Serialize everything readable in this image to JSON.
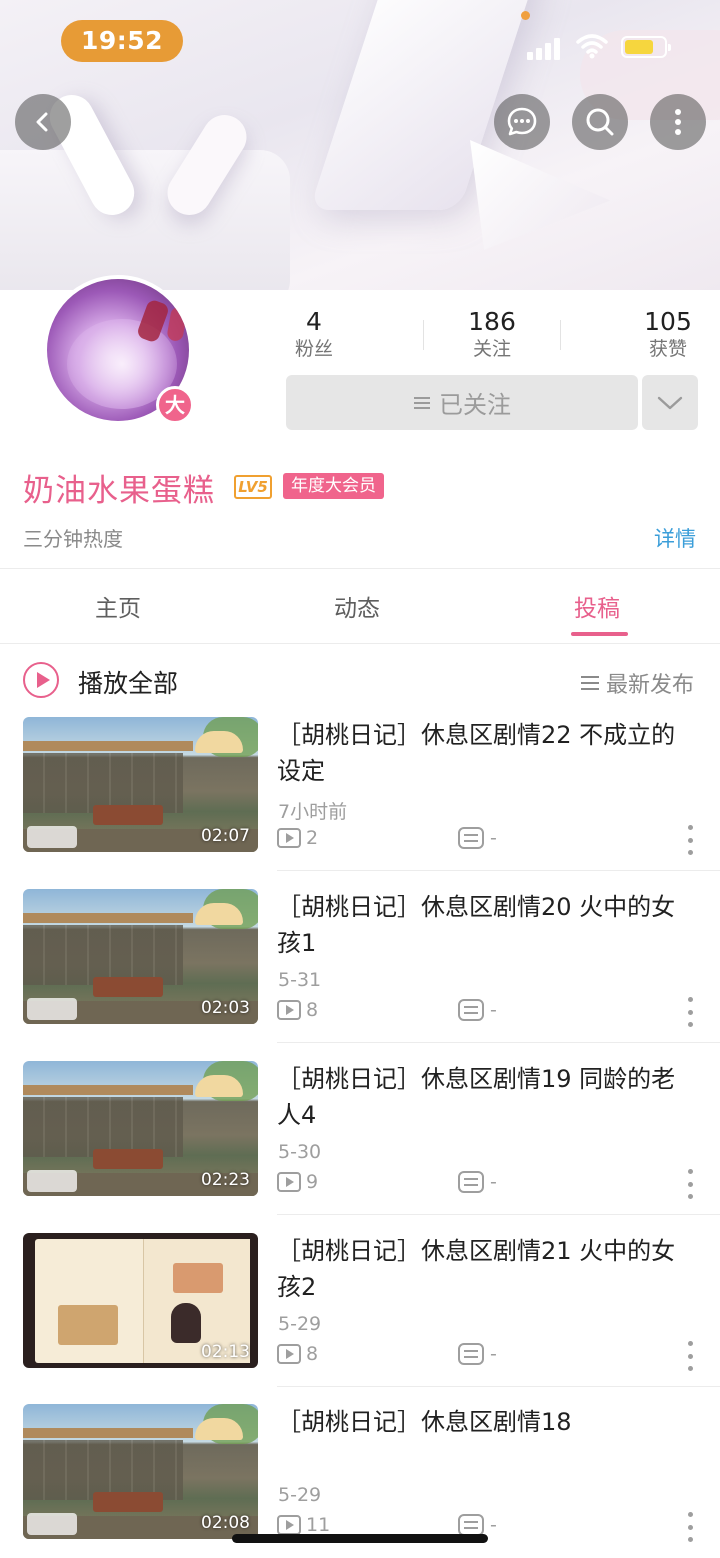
{
  "status_bar": {
    "time": "19:52"
  },
  "profile": {
    "avatar_badge": "大",
    "stats": [
      {
        "value": "4",
        "label": "粉丝"
      },
      {
        "value": "186",
        "label": "关注"
      },
      {
        "value": "105",
        "label": "获赞"
      }
    ],
    "follow_button": "已关注",
    "username": "奶油水果蛋糕",
    "level": "LV5",
    "vip_tag": "年度大会员",
    "bio": "三分钟热度",
    "detail_link": "详情"
  },
  "tabs": [
    {
      "label": "主页",
      "active": false
    },
    {
      "label": "动态",
      "active": false
    },
    {
      "label": "投稿",
      "active": true
    }
  ],
  "list_header": {
    "play_all": "播放全部",
    "sort": "最新发布"
  },
  "videos": [
    {
      "title": "［胡桃日记］休息区剧情22 不成立的设定",
      "date": "7小时前",
      "plays": "2",
      "danmaku": "-",
      "duration": "02:07",
      "thumb": "scene"
    },
    {
      "title": "［胡桃日记］休息区剧情20 火中的女孩1",
      "date": "5-31",
      "plays": "8",
      "danmaku": "-",
      "duration": "02:03",
      "thumb": "scene"
    },
    {
      "title": "［胡桃日记］休息区剧情19 同龄的老人4",
      "date": "5-30",
      "plays": "9",
      "danmaku": "-",
      "duration": "02:23",
      "thumb": "scene"
    },
    {
      "title": "［胡桃日记］休息区剧情21 火中的女孩2",
      "date": "5-29",
      "plays": "8",
      "danmaku": "-",
      "duration": "02:13",
      "thumb": "book"
    },
    {
      "title": "［胡桃日记］休息区剧情18",
      "date": "5-29",
      "plays": "11",
      "danmaku": "-",
      "duration": "02:08",
      "thumb": "scene"
    }
  ],
  "colors": {
    "accent": "#e8608c",
    "link": "#3b9ed9",
    "time_pill": "#e79b36"
  }
}
